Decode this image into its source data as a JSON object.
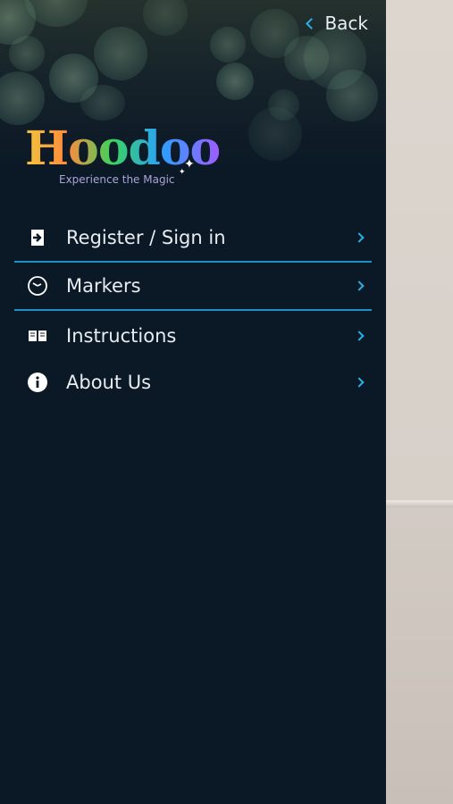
{
  "header": {
    "back_label": "Back"
  },
  "logo": {
    "name": "Hoodoo",
    "tagline": "Experience the Magic"
  },
  "menu": {
    "items": [
      {
        "label": "Register / Sign in",
        "icon": "sign-in-icon"
      },
      {
        "label": "Markers",
        "icon": "clock-icon"
      },
      {
        "label": "Instructions",
        "icon": "book-icon"
      },
      {
        "label": "About Us",
        "icon": "info-icon"
      }
    ]
  },
  "colors": {
    "drawer_bg": "#0b1826",
    "accent": "#2bb1e6",
    "divider": "#1e8fc2",
    "text": "#e7ecf0"
  }
}
